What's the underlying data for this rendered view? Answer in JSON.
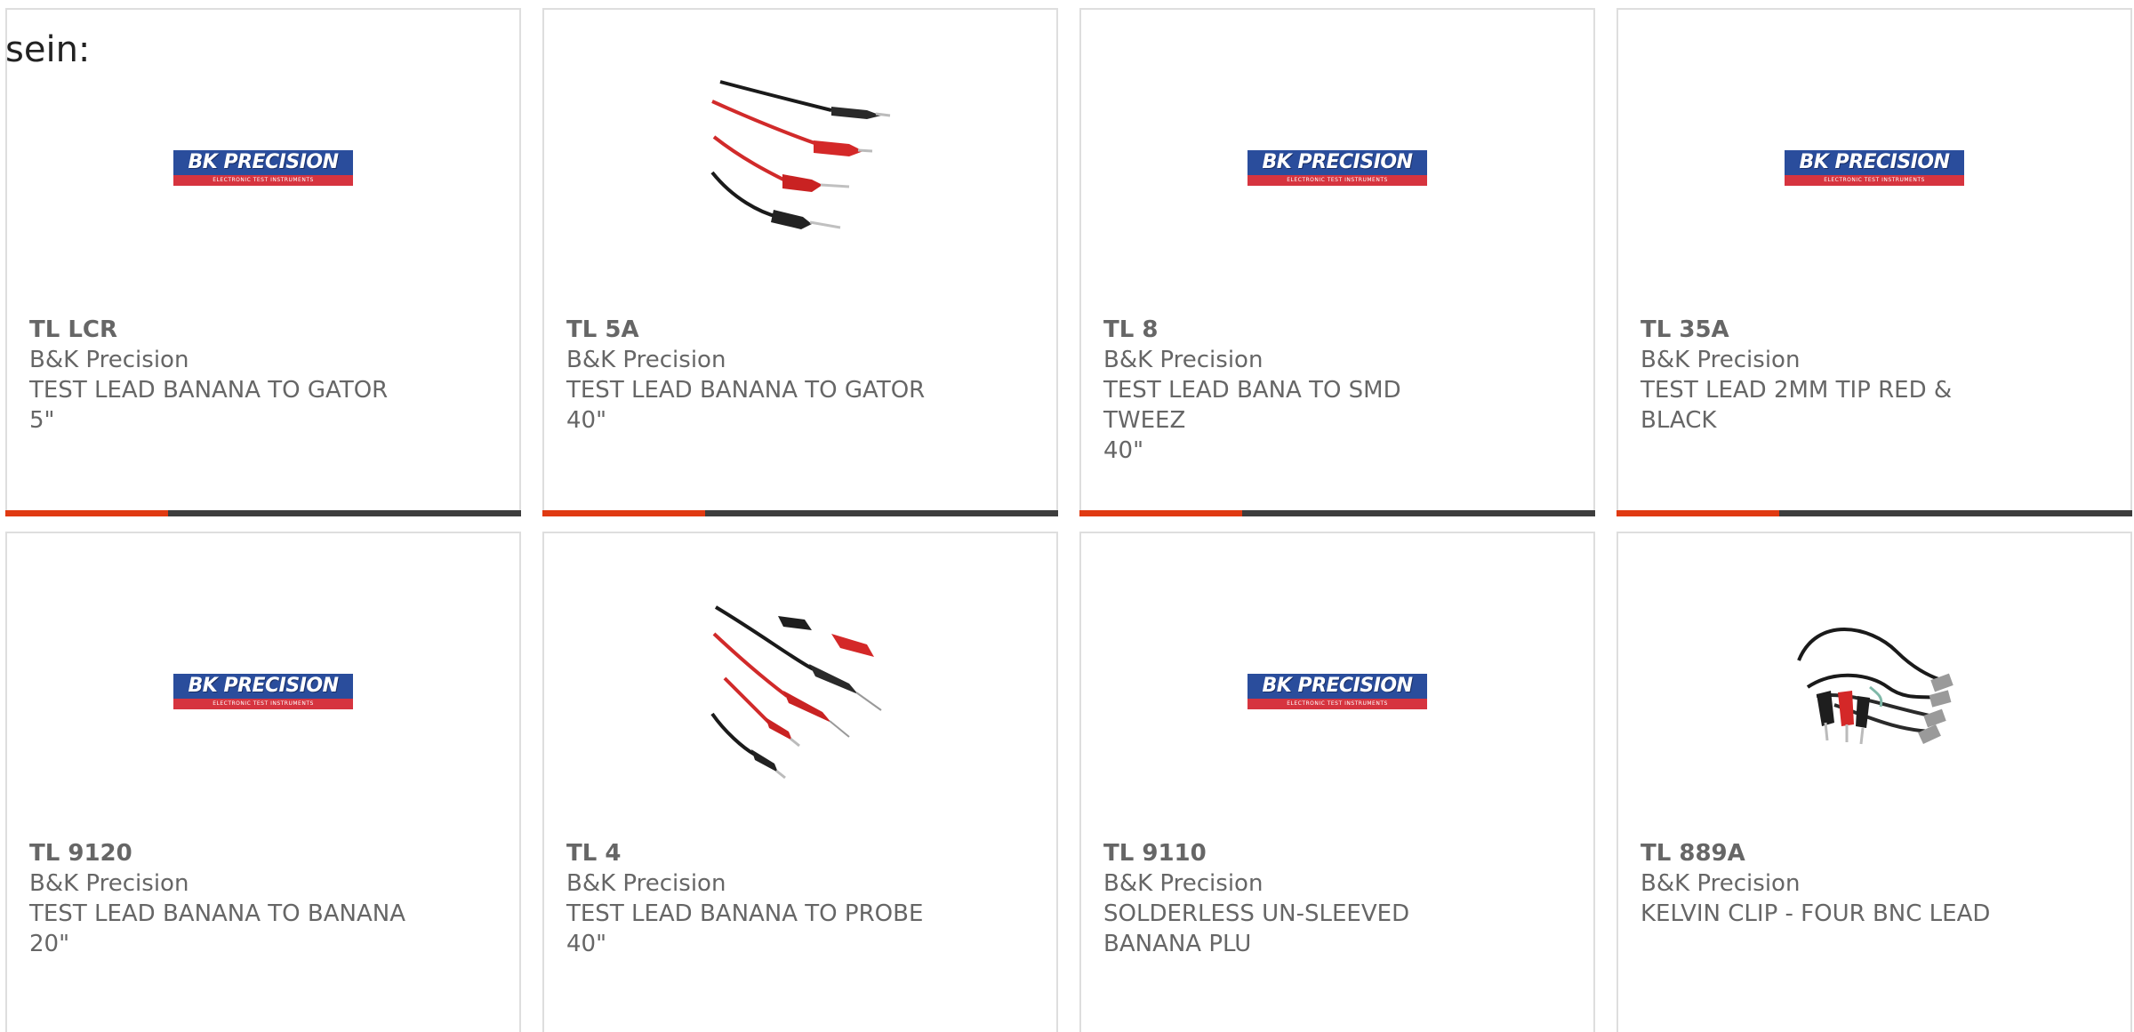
{
  "intro_text": "sein:",
  "logo": {
    "brand": "BK PRECISION",
    "tagline": "ELECTRONIC TEST INSTRUMENTS"
  },
  "colors": {
    "accent": "#e03a12",
    "bar": "#3d3d3d",
    "text": "#666666",
    "border": "#dedede"
  },
  "products": [
    {
      "part": "TL LCR",
      "brand": "B&K Precision",
      "desc1": "TEST LEAD BANANA TO GATOR",
      "desc2": "5\"",
      "image": "logo"
    },
    {
      "part": "TL 5A",
      "brand": "B&K Precision",
      "desc1": "TEST LEAD BANANA TO GATOR",
      "desc2": "40\"",
      "image": "gator-leads-photo"
    },
    {
      "part": "TL 8",
      "brand": "B&K Precision",
      "desc1": "TEST LEAD BANA TO SMD TWEEZ",
      "desc2": "40\"",
      "image": "logo"
    },
    {
      "part": "TL 35A",
      "brand": "B&K Precision",
      "desc1": "TEST LEAD 2MM TIP RED &",
      "desc2": "BLACK",
      "image": "logo"
    },
    {
      "part": "TL 9120",
      "brand": "B&K Precision",
      "desc1": "TEST LEAD BANANA TO BANANA",
      "desc2": "20\"",
      "image": "logo"
    },
    {
      "part": "TL 4",
      "brand": "B&K Precision",
      "desc1": "TEST LEAD BANANA TO PROBE",
      "desc2": "40\"",
      "image": "probe-leads-photo"
    },
    {
      "part": "TL 9110",
      "brand": "B&K Precision",
      "desc1": "SOLDERLESS UN-SLEEVED",
      "desc2": "BANANA PLU",
      "image": "logo"
    },
    {
      "part": "TL 889A",
      "brand": "B&K Precision",
      "desc1": "KELVIN CLIP - FOUR BNC LEAD",
      "desc2": "",
      "image": "kelvin-clip-photo"
    }
  ]
}
